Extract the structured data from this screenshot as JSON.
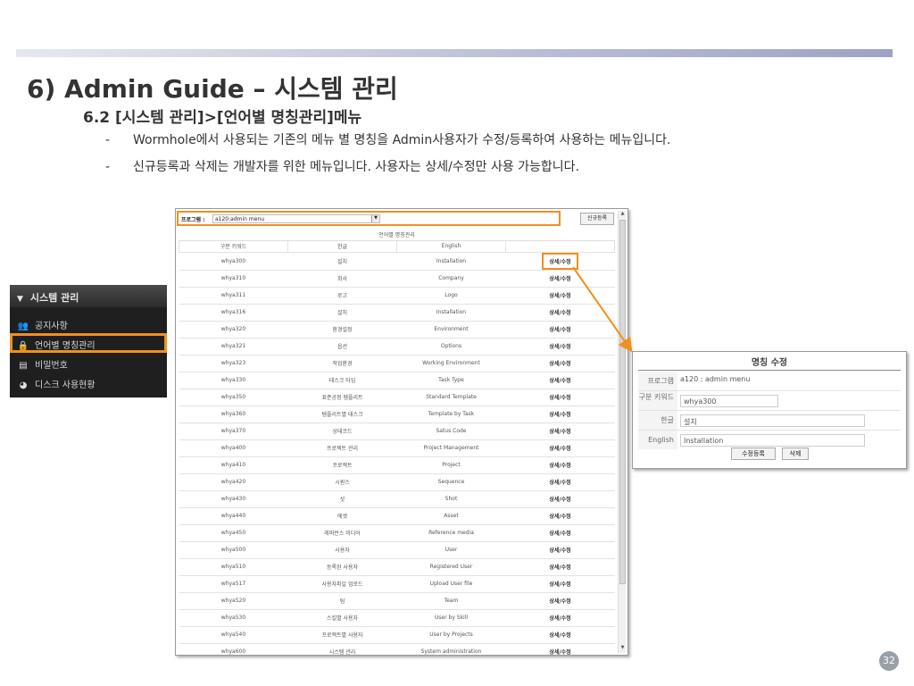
{
  "title": "6) Admin Guide – 시스템 관리",
  "subtitle": "6.2 [시스템 관리]>[언어별 명칭관리]메뉴",
  "bullets": [
    "Wormhole에서 사용되는 기존의 메뉴 별 명칭을 Admin사용자가 수정/등록하여 사용하는 메뉴입니다.",
    "신규등록과 삭제는 개발자를 위한 메뉴입니다. 사용자는 상세/수정만 사용 가능합니다."
  ],
  "bullet_dash": "-",
  "sidebar": {
    "header": "시스템 관리",
    "header_icon": "triangle-down-icon",
    "items": [
      {
        "label": "공지사항",
        "icon": "people-icon"
      },
      {
        "label": "언어별 명칭관리",
        "icon": "lock-icon",
        "active": true
      },
      {
        "label": "비밀번호",
        "icon": "inbox-icon"
      },
      {
        "label": "디스크 사용현황",
        "icon": "pie-chart-icon"
      }
    ]
  },
  "main": {
    "program_label": "프로그램 :",
    "program_value": "a120:admin menu",
    "new_button": "신규등록",
    "table_caption": "언어별 명칭관리",
    "columns": [
      "구분 키워드",
      "한글",
      "English",
      ""
    ],
    "action_label": "상세/수정",
    "rows": [
      [
        "whya300",
        "설치",
        "Installation"
      ],
      [
        "whya310",
        "회사",
        "Company"
      ],
      [
        "whya311",
        "로고",
        "Logo"
      ],
      [
        "whya316",
        "설치",
        "Installation"
      ],
      [
        "whya320",
        "환경설정",
        "Environment"
      ],
      [
        "whya321",
        "옵션",
        "Options"
      ],
      [
        "whya323",
        "작업환경",
        "Working Environment"
      ],
      [
        "whya330",
        "태스크 타입",
        "Task Type"
      ],
      [
        "whya350",
        "표준공정 템플리트",
        "Standard Template"
      ],
      [
        "whya360",
        "템플리트별 태스크",
        "Template by Task"
      ],
      [
        "whya370",
        "상태코드",
        "Satus Code"
      ],
      [
        "whya400",
        "프로젝트 관리",
        "Project Management"
      ],
      [
        "whya410",
        "프로젝트",
        "Project"
      ],
      [
        "whya420",
        "시퀀스",
        "Sequence"
      ],
      [
        "whya430",
        "샷",
        "Shot"
      ],
      [
        "whya440",
        "에셋",
        "Asset"
      ],
      [
        "whya450",
        "레퍼런스 미디어",
        "Reference media"
      ],
      [
        "whya500",
        "사용자",
        "User"
      ],
      [
        "whya510",
        "등록된 사용자",
        "Registered User"
      ],
      [
        "whya517",
        "사용자파일 업로드",
        "Upload User file"
      ],
      [
        "whya520",
        "팀",
        "Team"
      ],
      [
        "whya530",
        "스킬별 사용자",
        "User by Skill"
      ],
      [
        "whya540",
        "프로젝트별 사용자",
        "User by Projects"
      ],
      [
        "whya600",
        "시스템 관리",
        "System administration"
      ]
    ]
  },
  "edit_dialog": {
    "title": "명칭 수정",
    "program_label": "프로그램",
    "program_value": "a120 : admin menu",
    "keyword_label": "구분 키워드",
    "keyword_value": "whya300",
    "korean_label": "한글",
    "korean_value": "설치",
    "english_label": "English",
    "english_value": "Installation",
    "save_button": "수정등록",
    "delete_button": "삭제"
  },
  "page_number": "32",
  "colors": {
    "highlight": "#f0901e",
    "sidebar_bg": "#1f1f1f"
  }
}
